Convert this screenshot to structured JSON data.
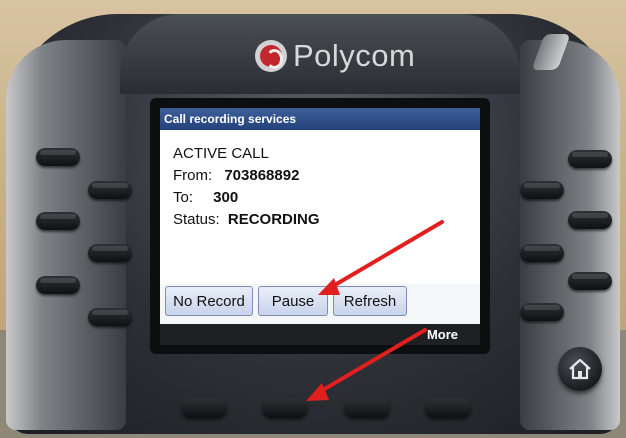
{
  "brand": {
    "name": "Polycom"
  },
  "screen": {
    "title": "Call recording services",
    "lines": [
      {
        "label": "ACTIVE CALL",
        "value": ""
      },
      {
        "label": "From:",
        "value": "703868892"
      },
      {
        "label": "To:",
        "value": "300"
      },
      {
        "label": "Status:",
        "value": "RECORDING"
      }
    ],
    "softkeys": [
      "No Record",
      "Pause",
      "Refresh"
    ],
    "more_label": "More"
  },
  "icons": {
    "home": "home-icon",
    "logo": "polycom-logo-icon"
  },
  "colors": {
    "title_bar": "#24427a",
    "softkey": "#c8d3ec",
    "annotation_arrow": "#e11f1f"
  }
}
